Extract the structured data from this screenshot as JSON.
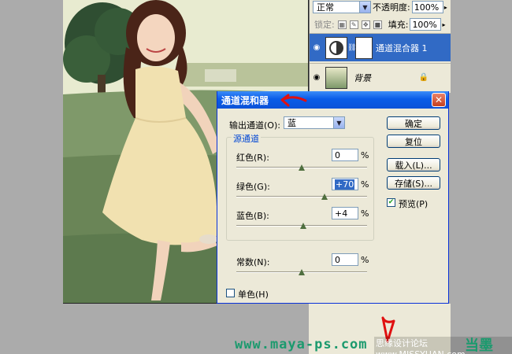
{
  "layers_panel": {
    "blend_mode": "正常",
    "opacity_label": "不透明度:",
    "opacity_value": "100%",
    "lock_label": "锁定:",
    "fill_label": "填充:",
    "fill_value": "100%",
    "layers": [
      {
        "name": "通道混合器 1",
        "selected": true
      },
      {
        "name": "背景",
        "selected": false
      }
    ]
  },
  "dialog": {
    "title": "通道混和器",
    "close_symbol": "✕",
    "output_channel_label": "输出通道(O):",
    "output_channel_value": "蓝",
    "source_group_label": "源通道",
    "red_label": "红色(R):",
    "red_value": "0",
    "green_label": "绿色(G):",
    "green_value": "+70",
    "blue_label": "蓝色(B):",
    "blue_value": "+4",
    "constant_label": "常数(N):",
    "constant_value": "0",
    "percent": "%",
    "ok_label": "确定",
    "reset_label": "复位",
    "load_label": "载入(L)...",
    "save_label": "存储(S)...",
    "preview_label": "预览(P)",
    "preview_checked": true,
    "monochrome_label": "单色(H)",
    "monochrome_checked": false
  },
  "slider_levels": {
    "red": 0,
    "green": 70,
    "blue": 4,
    "constant": 0
  },
  "watermark": {
    "url": "www.maya-ps.com",
    "site": "思缘设计论坛 www.MISSYUAN.com",
    "brand": "当墨"
  },
  "colors": {
    "titlebar": "#0a5ce8",
    "selection": "#316ac5",
    "watermark": "#1c9a6e",
    "dialog_bg": "#ece9d8"
  }
}
